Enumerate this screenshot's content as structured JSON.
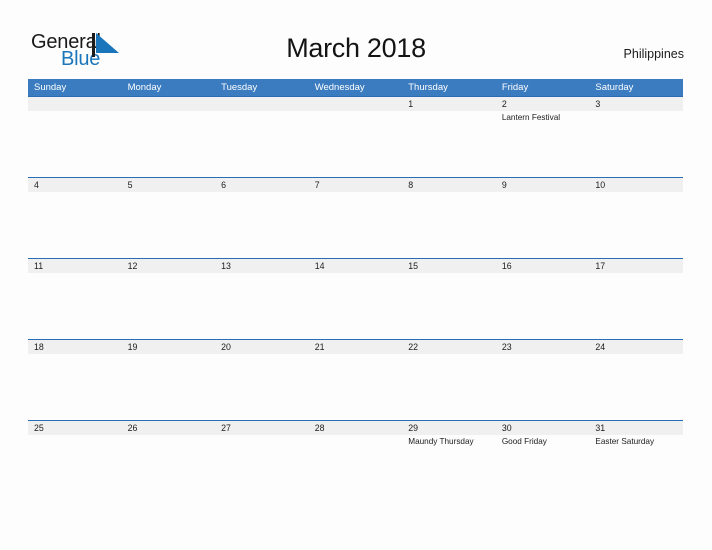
{
  "brand": {
    "word_one": "General",
    "word_two": "Blue",
    "flag_icon": "blue-flag-triangle-icon",
    "color_primary": "#1b75bb",
    "color_dark": "#1a1a1a"
  },
  "header": {
    "title": "March 2018",
    "country": "Philippines"
  },
  "theme": {
    "header_bar": "#3b7cc0",
    "band_border": "#2a6db3",
    "band_bg": "#f0f0f0",
    "page_bg": "#fdfdfd",
    "text": "#1c1c1c"
  },
  "calendar": {
    "month": "March",
    "year": "2018",
    "weekdays": [
      "Sunday",
      "Monday",
      "Tuesday",
      "Wednesday",
      "Thursday",
      "Friday",
      "Saturday"
    ],
    "weeks": [
      [
        {
          "date": "",
          "event": ""
        },
        {
          "date": "",
          "event": ""
        },
        {
          "date": "",
          "event": ""
        },
        {
          "date": "",
          "event": ""
        },
        {
          "date": "1",
          "event": ""
        },
        {
          "date": "2",
          "event": "Lantern Festival"
        },
        {
          "date": "3",
          "event": ""
        }
      ],
      [
        {
          "date": "4",
          "event": ""
        },
        {
          "date": "5",
          "event": ""
        },
        {
          "date": "6",
          "event": ""
        },
        {
          "date": "7",
          "event": ""
        },
        {
          "date": "8",
          "event": ""
        },
        {
          "date": "9",
          "event": ""
        },
        {
          "date": "10",
          "event": ""
        }
      ],
      [
        {
          "date": "11",
          "event": ""
        },
        {
          "date": "12",
          "event": ""
        },
        {
          "date": "13",
          "event": ""
        },
        {
          "date": "14",
          "event": ""
        },
        {
          "date": "15",
          "event": ""
        },
        {
          "date": "16",
          "event": ""
        },
        {
          "date": "17",
          "event": ""
        }
      ],
      [
        {
          "date": "18",
          "event": ""
        },
        {
          "date": "19",
          "event": ""
        },
        {
          "date": "20",
          "event": ""
        },
        {
          "date": "21",
          "event": ""
        },
        {
          "date": "22",
          "event": ""
        },
        {
          "date": "23",
          "event": ""
        },
        {
          "date": "24",
          "event": ""
        }
      ],
      [
        {
          "date": "25",
          "event": ""
        },
        {
          "date": "26",
          "event": ""
        },
        {
          "date": "27",
          "event": ""
        },
        {
          "date": "28",
          "event": ""
        },
        {
          "date": "29",
          "event": "Maundy Thursday"
        },
        {
          "date": "30",
          "event": "Good Friday"
        },
        {
          "date": "31",
          "event": "Easter Saturday"
        }
      ]
    ]
  }
}
